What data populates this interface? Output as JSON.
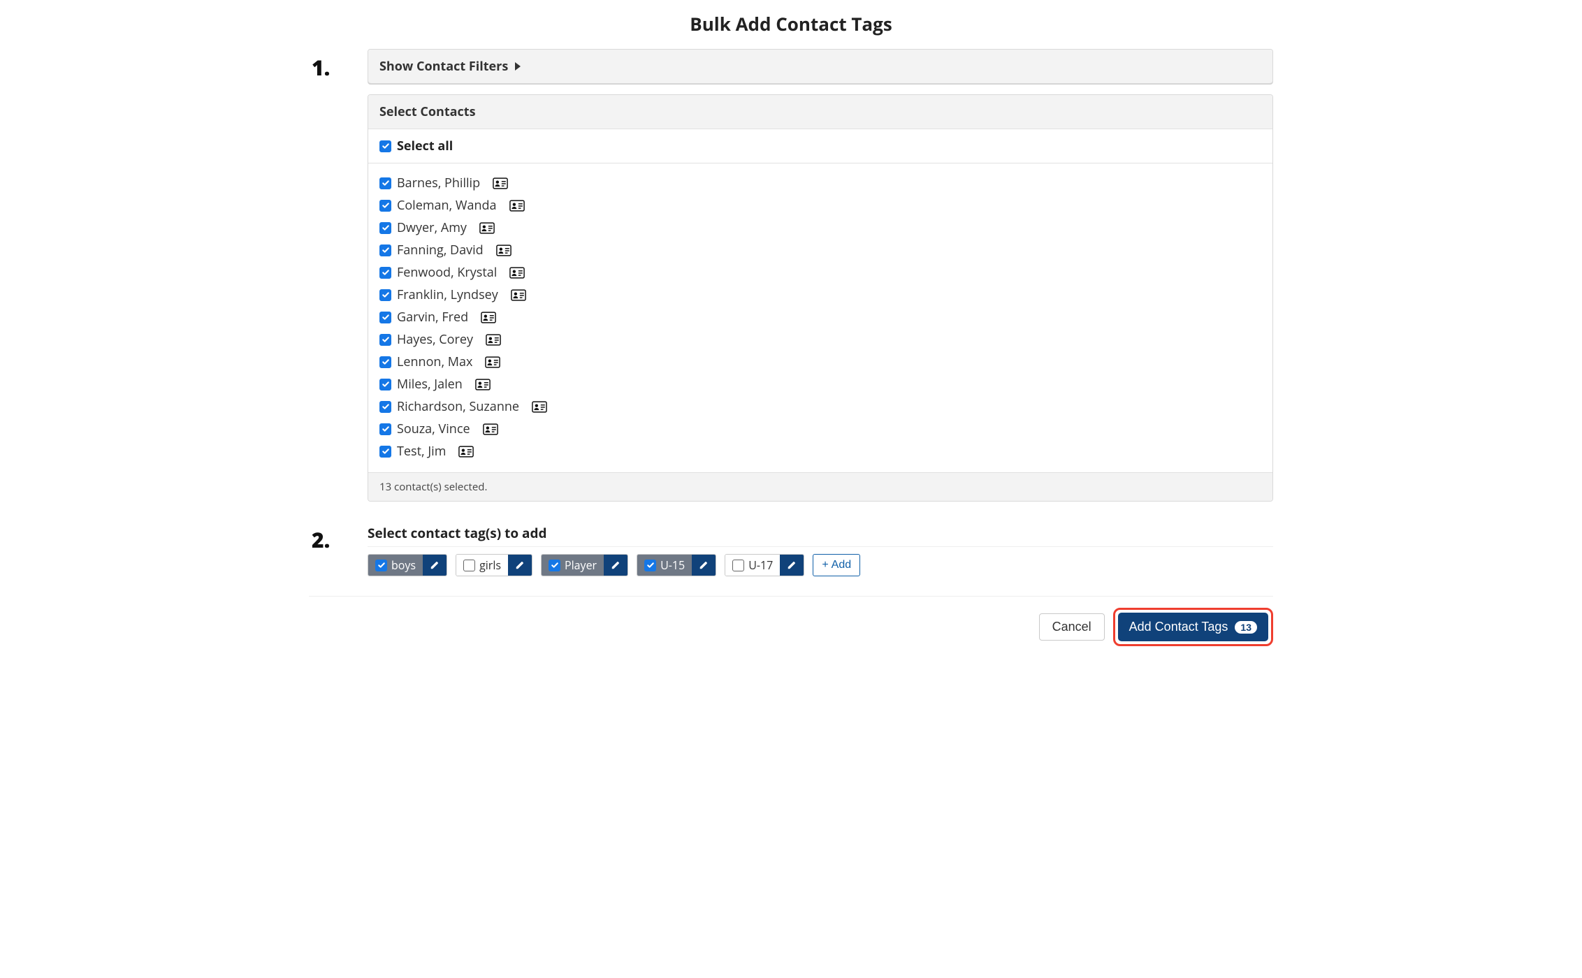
{
  "title": "Bulk Add Contact Tags",
  "steps": {
    "one": "1.",
    "two": "2."
  },
  "filters": {
    "toggle_label": "Show Contact Filters"
  },
  "contacts_panel": {
    "header": "Select Contacts",
    "select_all_label": "Select all",
    "select_all_checked": true,
    "summary": "13 contact(s) selected.",
    "items": [
      {
        "name": "Barnes, Phillip",
        "checked": true
      },
      {
        "name": "Coleman, Wanda",
        "checked": true
      },
      {
        "name": "Dwyer, Amy",
        "checked": true
      },
      {
        "name": "Fanning, David",
        "checked": true
      },
      {
        "name": "Fenwood, Krystal",
        "checked": true
      },
      {
        "name": "Franklin, Lyndsey",
        "checked": true
      },
      {
        "name": "Garvin, Fred",
        "checked": true
      },
      {
        "name": "Hayes, Corey",
        "checked": true
      },
      {
        "name": "Lennon, Max",
        "checked": true
      },
      {
        "name": "Miles, Jalen",
        "checked": true
      },
      {
        "name": "Richardson, Suzanne",
        "checked": true
      },
      {
        "name": "Souza, Vince",
        "checked": true
      },
      {
        "name": "Test, Jim",
        "checked": true
      }
    ]
  },
  "tags_section": {
    "label": "Select contact tag(s) to add",
    "add_button_label": "Add",
    "tags": [
      {
        "label": "boys",
        "checked": true
      },
      {
        "label": "girls",
        "checked": false
      },
      {
        "label": "Player",
        "checked": true
      },
      {
        "label": "U-15",
        "checked": true
      },
      {
        "label": "U-17",
        "checked": false
      }
    ]
  },
  "footer": {
    "cancel_label": "Cancel",
    "submit_label": "Add Contact Tags",
    "submit_count": "13"
  },
  "colors": {
    "primary": "#10427a",
    "checkbox_blue": "#1577e6",
    "highlight_ring": "#ef3e2f",
    "tag_selected_bg": "#6f7885"
  }
}
